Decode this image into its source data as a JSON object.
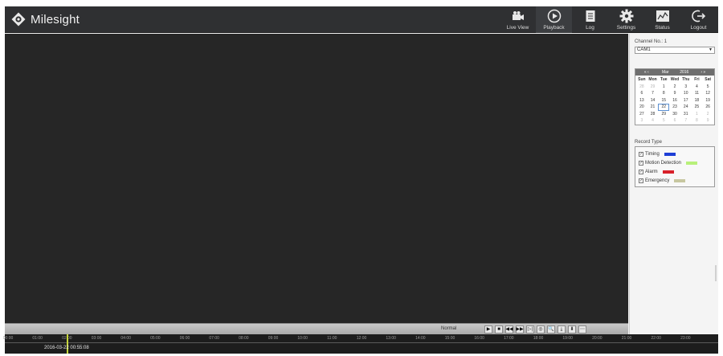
{
  "app": {
    "brand": "Milesight"
  },
  "nav": [
    {
      "label": "Live View",
      "icon": "camera-icon"
    },
    {
      "label": "Playback",
      "icon": "playback-icon"
    },
    {
      "label": "Log",
      "icon": "log-icon"
    },
    {
      "label": "Settings",
      "icon": "gear-icon"
    },
    {
      "label": "Status",
      "icon": "status-icon"
    },
    {
      "label": "Logout",
      "icon": "logout-icon"
    }
  ],
  "panel": {
    "channel_label": "Channel No.: 1",
    "channel_value": "CAM1",
    "calendar": {
      "prev": "« ‹",
      "month": "Mar",
      "year": "2016",
      "next": "› »",
      "weekdays": [
        "Sun",
        "Mon",
        "Tue",
        "Wed",
        "Thu",
        "Fri",
        "Sat"
      ],
      "days": [
        {
          "d": "28",
          "o": true
        },
        {
          "d": "29",
          "o": true
        },
        {
          "d": "1",
          "o": false
        },
        {
          "d": "2",
          "o": false
        },
        {
          "d": "3",
          "o": false
        },
        {
          "d": "4",
          "o": false
        },
        {
          "d": "5",
          "o": false
        },
        {
          "d": "6",
          "o": false
        },
        {
          "d": "7",
          "o": false
        },
        {
          "d": "8",
          "o": false
        },
        {
          "d": "9",
          "o": false
        },
        {
          "d": "10",
          "o": false
        },
        {
          "d": "11",
          "o": false
        },
        {
          "d": "12",
          "o": false
        },
        {
          "d": "13",
          "o": false
        },
        {
          "d": "14",
          "o": false
        },
        {
          "d": "15",
          "o": false
        },
        {
          "d": "16",
          "o": false
        },
        {
          "d": "17",
          "o": false
        },
        {
          "d": "18",
          "o": false
        },
        {
          "d": "19",
          "o": false
        },
        {
          "d": "20",
          "o": false
        },
        {
          "d": "21",
          "o": false
        },
        {
          "d": "22",
          "o": false
        },
        {
          "d": "23",
          "o": false
        },
        {
          "d": "24",
          "o": false
        },
        {
          "d": "25",
          "o": false
        },
        {
          "d": "26",
          "o": false
        },
        {
          "d": "27",
          "o": false
        },
        {
          "d": "28",
          "o": false
        },
        {
          "d": "29",
          "o": false
        },
        {
          "d": "30",
          "o": false
        },
        {
          "d": "31",
          "o": false
        },
        {
          "d": "1",
          "o": true
        },
        {
          "d": "2",
          "o": true
        },
        {
          "d": "3",
          "o": true
        },
        {
          "d": "4",
          "o": true
        },
        {
          "d": "5",
          "o": true
        },
        {
          "d": "6",
          "o": true
        },
        {
          "d": "7",
          "o": true
        },
        {
          "d": "8",
          "o": true
        },
        {
          "d": "9",
          "o": true
        }
      ],
      "selected_day": "22"
    },
    "record_type_label": "Record Type",
    "record_types": [
      {
        "label": "Timing",
        "color": "#1e3fd6",
        "checked": true
      },
      {
        "label": "Motion Detection",
        "color": "#b8f07a",
        "checked": true
      },
      {
        "label": "Alarm",
        "color": "#d8202a",
        "checked": true
      },
      {
        "label": "Emergency",
        "color": "#c7c7a0",
        "checked": true
      }
    ]
  },
  "controls": {
    "speed_label": "Normal",
    "buttons": [
      {
        "glyph": "▶",
        "icon": "play-icon"
      },
      {
        "glyph": "■",
        "icon": "stop-icon"
      },
      {
        "glyph": "◀◀",
        "icon": "rewind-icon"
      },
      {
        "glyph": "▶▶",
        "icon": "fast-forward-icon"
      },
      {
        "glyph": "▷|",
        "icon": "step-icon"
      },
      {
        "glyph": "◎",
        "icon": "capture-icon"
      },
      {
        "glyph": "🔍",
        "icon": "zoom-icon"
      },
      {
        "glyph": "⤓",
        "icon": "download-icon"
      },
      {
        "glyph": "⬇",
        "icon": "save-icon"
      },
      {
        "glyph": "⋯",
        "icon": "more-icon"
      }
    ]
  },
  "timeline": {
    "current_time": "2016-03-22 00:55:08",
    "ticks": [
      "00:00",
      "01:00",
      "02:00",
      "03:00",
      "04:00",
      "05:00",
      "06:00",
      "07:00",
      "08:00",
      "09:00",
      "10:00",
      "11:00",
      "12:00",
      "13:00",
      "14:00",
      "15:00",
      "16:00",
      "17:00",
      "18:00",
      "19:00",
      "20:00",
      "21:00",
      "22:00",
      "23:00"
    ]
  }
}
